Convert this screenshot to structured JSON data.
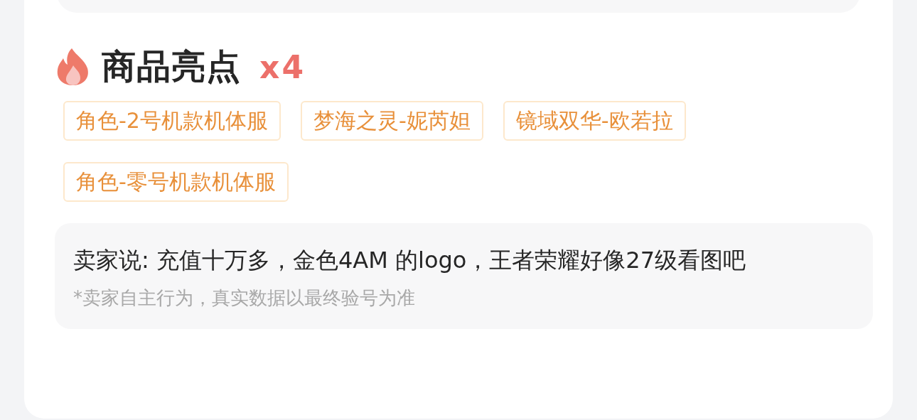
{
  "highlights": {
    "title": "商品亮点",
    "count": "x4",
    "tags": [
      {
        "label": "角色-2号机款机体服"
      },
      {
        "label": "梦海之灵-妮芮妲"
      },
      {
        "label": "镜域双华-欧若拉"
      },
      {
        "label": "角色-零号机款机体服"
      }
    ]
  },
  "seller_note": {
    "text": "卖家说: 充值十万多，金色4AM 的logo，王者荣耀好像27级看图吧",
    "disclaimer": "*卖家自主行为，真实数据以最终验号为准"
  }
}
